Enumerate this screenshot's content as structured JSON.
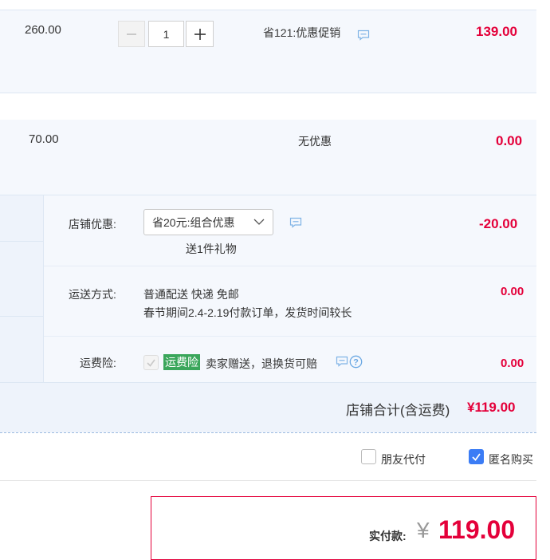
{
  "item1": {
    "unit_price": "260.00",
    "quantity": "1",
    "discount": "省121:优惠促销",
    "total": "139.00"
  },
  "item2": {
    "unit_price": "70.00",
    "discount": "无优惠",
    "total": "0.00"
  },
  "shop": {
    "coupon_label": "店铺优惠:",
    "coupon_value": "省20元:组合优惠",
    "coupon_gift": "送1件礼物",
    "coupon_amount": "-20.00",
    "shipping_label": "运送方式:",
    "shipping_line1": "普通配送 快递 免邮",
    "shipping_line2": "春节期间2.4-2.19付款订单，发货时间较长",
    "shipping_amount": "0.00",
    "insurance_label": "运费险:",
    "insurance_tag": "运费险",
    "insurance_text": "卖家赠送，退换货可赔",
    "insurance_amount": "0.00",
    "subtotal_label": "店铺合计(含运费)",
    "subtotal_value": "¥119.00"
  },
  "options": {
    "friend_pay": "朋友代付",
    "anonymous": "匿名购买",
    "anonymous_checked": true
  },
  "pay": {
    "label": "实付款:",
    "currency": "¥",
    "amount": "119.00"
  },
  "colors": {
    "accent_red": "#e4003a",
    "band_bg": "#f5f8fd",
    "checkbox_blue": "#3b7cf5",
    "tag_green": "#3aa65b"
  }
}
